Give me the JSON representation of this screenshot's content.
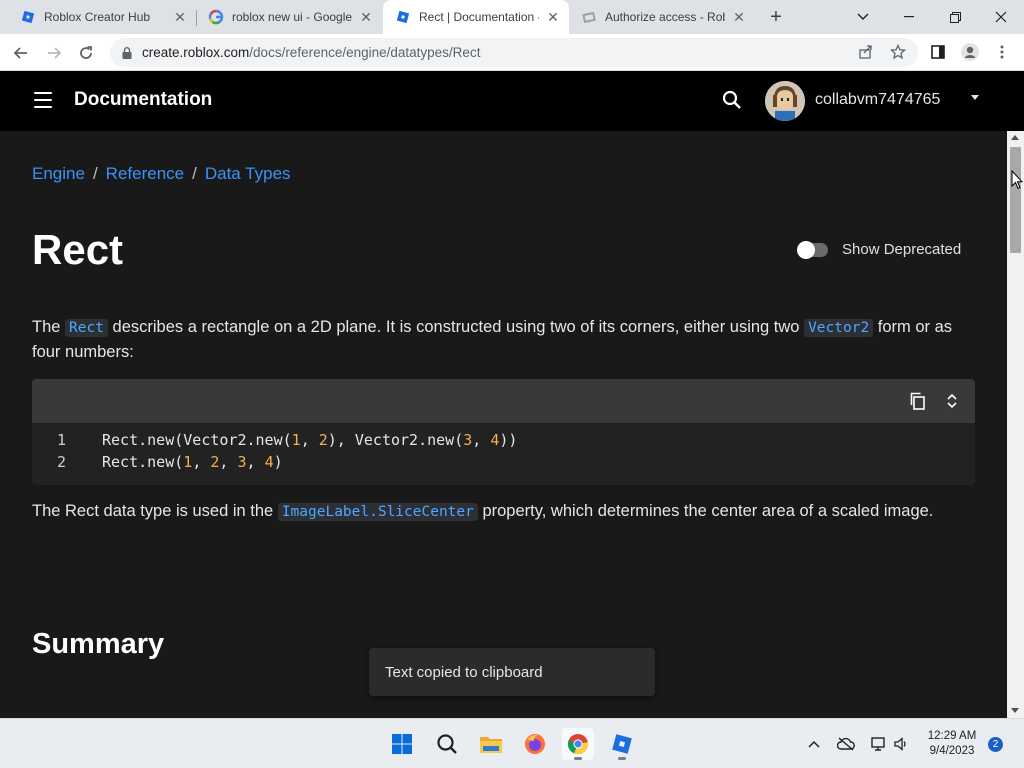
{
  "browser": {
    "tabs": [
      {
        "title": "Roblox Creator Hub",
        "active": false,
        "favicon": "roblox-studio-icon"
      },
      {
        "title": "roblox new ui - Google",
        "active": false,
        "favicon": "google-icon"
      },
      {
        "title": "Rect | Documentation -",
        "active": true,
        "favicon": "roblox-studio-icon"
      },
      {
        "title": "Authorize access - Rob",
        "active": false,
        "favicon": "authorize-icon"
      }
    ],
    "url": {
      "host": "create.roblox.com",
      "path": "/docs/reference/engine/datatypes/Rect"
    }
  },
  "site": {
    "title": "Documentation",
    "username": "collabvm7474765"
  },
  "breadcrumb": {
    "items": [
      "Engine",
      "Reference",
      "Data Types"
    ],
    "separator": "/"
  },
  "page": {
    "title": "Rect",
    "show_deprecated_label": "Show Deprecated",
    "intro": {
      "t1": "The ",
      "code1": "Rect",
      "t2": " describes a rectangle on a 2D plane. It is constructed using two of its corners, either using two ",
      "code2": "Vector2",
      "t3": " form or as four numbers:"
    },
    "code_lines": [
      {
        "number": "1",
        "a": "Rect.new(Vector2.new(",
        "n1": "1",
        "b": ", ",
        "n2": "2",
        "c": "), Vector2.new(",
        "n3": "3",
        "d": ", ",
        "n4": "4",
        "e": "))"
      },
      {
        "number": "2",
        "a": "Rect.new(",
        "n1": "1",
        "b": ", ",
        "n2": "2",
        "c": ", ",
        "n3": "3",
        "d": ", ",
        "n4": "4",
        "e": ")"
      }
    ],
    "usage": {
      "t1": "The Rect data type is used in the ",
      "code1": "ImageLabel.SliceCenter",
      "t2": " property, which determines the center area of a scaled image."
    },
    "summary_heading": "Summary",
    "toast": "Text copied to clipboard"
  },
  "taskbar": {
    "time": "12:29 AM",
    "date": "9/4/2023",
    "notifications": "2"
  },
  "colors": {
    "accent": "#3a93f5",
    "inline_code": "#4ea7ff",
    "number": "#f3b04a",
    "header_bg": "#000000",
    "page_bg": "#191919"
  }
}
